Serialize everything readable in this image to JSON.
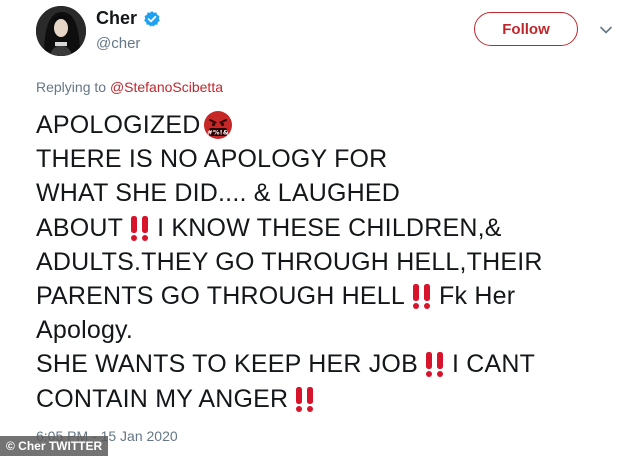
{
  "tweet": {
    "display_name": "Cher",
    "handle": "@cher",
    "verified_icon": "verified-badge-icon",
    "follow_label": "Follow",
    "menu_icon": "chevron-down-icon",
    "reply_prefix": "Replying to",
    "reply_to": "@StefanoScibetta",
    "body_lines": [
      {
        "text": "APOLOGIZED",
        "emoji_after": "angry-face-with-symbols"
      },
      {
        "text": "THERE IS NO APOLOGY FOR"
      },
      {
        "text": "WHAT SHE DID.... & LAUGHED"
      },
      {
        "text_before": "ABOUT",
        "emoji": "double-exclamation",
        "text_after": "I KNOW THESE CHILDREN,&"
      },
      {
        "text": "ADULTS.THEY GO THROUGH HELL,THEIR"
      },
      {
        "text_before": "PARENTS GO THROUGH HELL",
        "emoji": "double-exclamation",
        "text_after": "Fk Her"
      },
      {
        "text": "Apology."
      },
      {
        "text_before": "SHE WANTS TO KEEP HER JOB",
        "emoji": "double-exclamation",
        "text_after": "I CANT"
      },
      {
        "text_before": "CONTAIN MY ANGER",
        "emoji": "double-exclamation",
        "text_after": ""
      }
    ],
    "timestamp": "6:05 PM - 15 Jan 2020"
  },
  "photo_credit": "© Cher TWITTER",
  "colors": {
    "accent": "#c0272d",
    "verified": "#1da1f2",
    "secondary_text": "#657786",
    "primary_text": "#14171a"
  }
}
